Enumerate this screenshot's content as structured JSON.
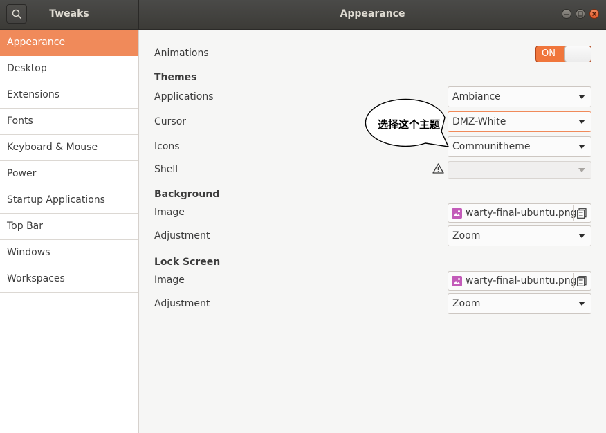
{
  "header": {
    "app_title": "Tweaks",
    "page_title": "Appearance"
  },
  "sidebar": {
    "items": [
      {
        "label": "Appearance",
        "active": true
      },
      {
        "label": "Desktop"
      },
      {
        "label": "Extensions"
      },
      {
        "label": "Fonts"
      },
      {
        "label": "Keyboard & Mouse"
      },
      {
        "label": "Power"
      },
      {
        "label": "Startup Applications"
      },
      {
        "label": "Top Bar"
      },
      {
        "label": "Windows"
      },
      {
        "label": "Workspaces"
      }
    ]
  },
  "appearance": {
    "animations": {
      "label": "Animations",
      "toggle_text": "ON"
    },
    "themes": {
      "heading": "Themes",
      "applications": {
        "label": "Applications",
        "value": "Ambiance"
      },
      "cursor": {
        "label": "Cursor",
        "value": "DMZ-White"
      },
      "icons": {
        "label": "Icons",
        "value": "Communitheme"
      },
      "shell": {
        "label": "Shell",
        "value": ""
      }
    },
    "background": {
      "heading": "Background",
      "image": {
        "label": "Image",
        "file": "warty-final-ubuntu.png"
      },
      "adjustment": {
        "label": "Adjustment",
        "value": "Zoom"
      }
    },
    "lock_screen": {
      "heading": "Lock Screen",
      "image": {
        "label": "Image",
        "file": "warty-final-ubuntu.png"
      },
      "adjustment": {
        "label": "Adjustment",
        "value": "Zoom"
      }
    }
  },
  "annotation": {
    "text": "选择这个主题"
  },
  "colors": {
    "accent": "#f08a5a",
    "toggle_on": "#f0763c",
    "header_bg": "#3c3b37",
    "file_icon": "#c35bb9"
  },
  "icons": [
    "search-icon",
    "minimize-icon",
    "maximize-icon",
    "close-icon",
    "chevron-down-icon",
    "warning-icon",
    "image-file-icon",
    "document-icon"
  ]
}
